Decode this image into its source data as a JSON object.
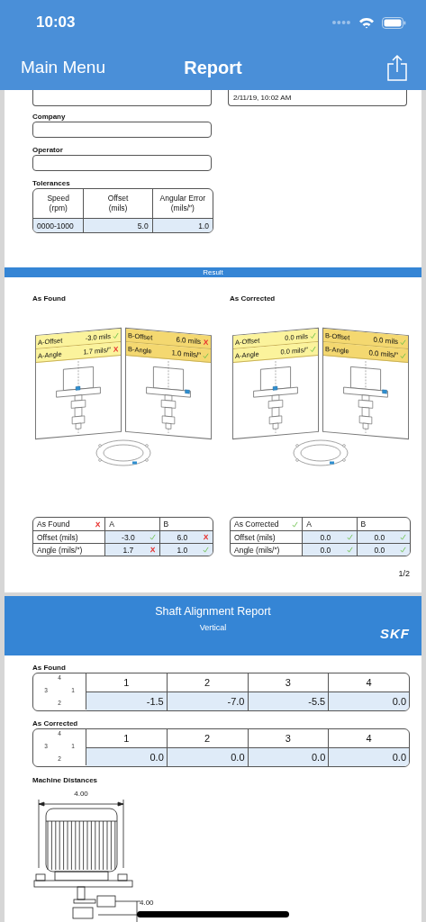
{
  "status_bar": {
    "time": "10:03"
  },
  "nav": {
    "back": "Main Menu",
    "title": "Report"
  },
  "report_page": {
    "date_field": {
      "value": "2/11/19, 10:02 AM"
    },
    "fields": [
      {
        "label": "Company"
      },
      {
        "label": "Operator"
      }
    ],
    "tolerances": {
      "title": "Tolerances",
      "columns": [
        [
          "Speed",
          "(rpm)"
        ],
        [
          "Offset",
          "(mils)"
        ],
        [
          "Angular Error",
          "(mils/″)"
        ]
      ],
      "row": [
        "0000-1000",
        "5.0",
        "1.0"
      ]
    },
    "section_title": "Result",
    "results": [
      {
        "title": "As Found",
        "sheets": [
          {
            "rows": [
              {
                "label": "A-Offset",
                "value": "-3.0 mils",
                "ok": true
              },
              {
                "label": "A-Angle",
                "value": "1.7 mils/″",
                "ok": false
              }
            ]
          },
          {
            "rows": [
              {
                "label": "B-Offset",
                "value": "6.0 mils",
                "ok": false
              },
              {
                "label": "B-Angle",
                "value": "1.0 mils/″",
                "ok": true
              }
            ]
          }
        ],
        "table": {
          "title": "As Found",
          "ok": false,
          "columns": [
            "A",
            "B"
          ],
          "rows": [
            {
              "label": "Offset (mils)",
              "cells": [
                {
                  "value": "-3.0",
                  "ok": true
                },
                {
                  "value": "6.0",
                  "ok": false
                }
              ]
            },
            {
              "label": "Angle (mils/″)",
              "cells": [
                {
                  "value": "1.7",
                  "ok": false
                },
                {
                  "value": "1.0",
                  "ok": true
                }
              ]
            }
          ]
        }
      },
      {
        "title": "As Corrected",
        "sheets": [
          {
            "rows": [
              {
                "label": "A-Offset",
                "value": "0.0 mils",
                "ok": true
              },
              {
                "label": "A-Angle",
                "value": "0.0 mils/″",
                "ok": true
              }
            ]
          },
          {
            "rows": [
              {
                "label": "B-Offset",
                "value": "0.0 mils",
                "ok": true
              },
              {
                "label": "B-Angle",
                "value": "0.0 mils/″",
                "ok": true
              }
            ]
          }
        ],
        "table": {
          "title": "As Corrected",
          "ok": true,
          "columns": [
            "A",
            "B"
          ],
          "rows": [
            {
              "label": "Offset (mils)",
              "cells": [
                {
                  "value": "0.0",
                  "ok": true
                },
                {
                  "value": "0.0",
                  "ok": true
                }
              ]
            },
            {
              "label": "Angle (mils/″)",
              "cells": [
                {
                  "value": "0.0",
                  "ok": true
                },
                {
                  "value": "0.0",
                  "ok": true
                }
              ]
            }
          ]
        }
      }
    ],
    "page_number": "1/2"
  },
  "summary_page": {
    "title": "Shaft Alignment Report",
    "subtitle": "Vertical",
    "logo": "SKF",
    "readings": [
      {
        "title": "As Found",
        "positions": [
          "4",
          "3",
          "1",
          "2"
        ],
        "columns": [
          "1",
          "2",
          "3",
          "4"
        ],
        "values": [
          "-1.5",
          "-7.0",
          "-5.5",
          "0.0"
        ]
      },
      {
        "title": "As Corrected",
        "positions": [
          "4",
          "3",
          "1",
          "2"
        ],
        "columns": [
          "1",
          "2",
          "3",
          "4"
        ],
        "values": [
          "0.0",
          "0.0",
          "0.0",
          "0.0"
        ]
      }
    ],
    "machine_distances": {
      "title": "Machine Distances",
      "labels": [
        "4.00",
        "4.00"
      ]
    }
  }
}
